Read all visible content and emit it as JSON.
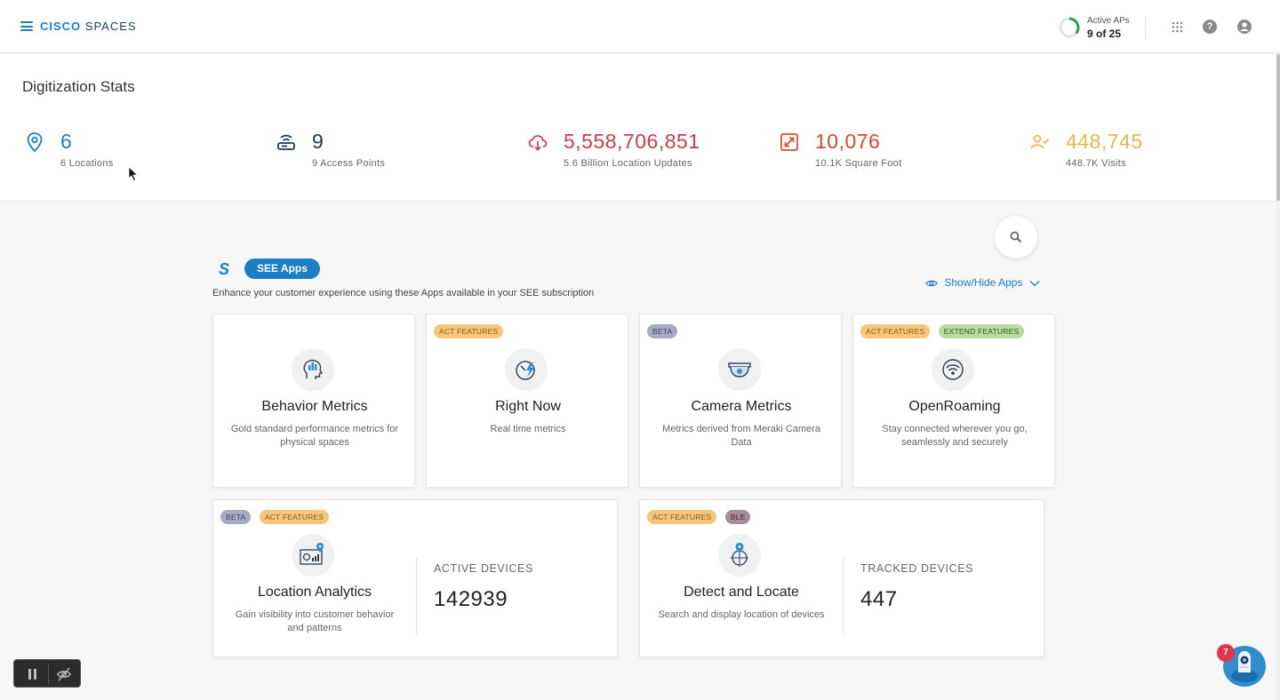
{
  "header": {
    "brand_bold": "CISCO",
    "brand_light": "SPACES",
    "active_aps_label": "Active APs",
    "active_aps_value": "9 of 25",
    "active_aps_fraction": 0.36,
    "icons": [
      "menu-icon",
      "apps-grid-icon",
      "help-icon",
      "user-icon"
    ],
    "help_glyph": "?"
  },
  "stats": {
    "title": "Digitization Stats",
    "items": [
      {
        "value": "6",
        "sub": "6 Locations",
        "color": "#1a7fc4",
        "icon": "location-pin-icon"
      },
      {
        "value": "9",
        "sub": "9 Access Points",
        "color": "#1b3a57",
        "icon": "access-point-icon"
      },
      {
        "value": "5,558,706,851",
        "sub": "5.6 Billion Location Updates",
        "color": "#cf3b4a",
        "icon": "cloud-download-icon"
      },
      {
        "value": "10,076",
        "sub": "10.1K Square Foot",
        "color": "#d9492a",
        "icon": "expand-icon"
      },
      {
        "value": "448,745",
        "sub": "448.7K Visits",
        "color": "#e8b84a",
        "icon": "visitor-icon"
      }
    ]
  },
  "apps_section": {
    "pill_label": "SEE Apps",
    "logo_glyph": "S",
    "description": "Enhance your customer experience using these Apps available in your SEE subscription",
    "show_hide_label": "Show/Hide Apps",
    "search_icon": "search-icon"
  },
  "apps": [
    {
      "name": "Behavior Metrics",
      "desc": "Gold standard performance metrics for physical spaces",
      "badges": []
    },
    {
      "name": "Right Now",
      "desc": "Real time metrics",
      "badges": [
        "ACT FEATURES"
      ]
    },
    {
      "name": "Camera Metrics",
      "desc": "Metrics derived from Meraki Camera Data",
      "badges": [
        "BETA"
      ]
    },
    {
      "name": "OpenRoaming",
      "desc": "Stay connected wherever you go, seamlessly and securely",
      "badges": [
        "ACT FEATURES",
        "EXTEND FEATURES"
      ]
    }
  ],
  "wide_apps": [
    {
      "name": "Location Analytics",
      "desc": "Gain visibility into customer behavior and patterns",
      "badges": [
        "BETA",
        "ACT FEATURES"
      ],
      "metric_label": "ACTIVE DEVICES",
      "metric_value": "142939"
    },
    {
      "name": "Detect and Locate",
      "desc": "Search and display location of devices",
      "badges": [
        "ACT FEATURES",
        "BLE"
      ],
      "metric_label": "TRACKED DEVICES",
      "metric_value": "447"
    }
  ],
  "assistant": {
    "badge_count": "7"
  }
}
